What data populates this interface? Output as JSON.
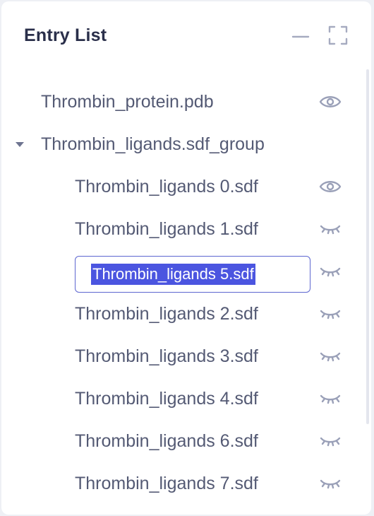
{
  "panel": {
    "title": "Entry List"
  },
  "entries": [
    {
      "label": "Thrombin_protein.pdb",
      "visibility": "visible"
    },
    {
      "label": "Thrombin_ligands.sdf_group",
      "expanded": true
    },
    {
      "label": "Thrombin_ligands 0.sdf",
      "visibility": "visible"
    },
    {
      "label": "Thrombin_ligands 1.sdf",
      "visibility": "hidden"
    },
    {
      "label": "Thrombin_ligands 5.sdf",
      "visibility": "hidden",
      "editing": true
    },
    {
      "label": "Thrombin_ligands 2.sdf",
      "visibility": "hidden"
    },
    {
      "label": "Thrombin_ligands 3.sdf",
      "visibility": "hidden"
    },
    {
      "label": "Thrombin_ligands 4.sdf",
      "visibility": "hidden"
    },
    {
      "label": "Thrombin_ligands 6.sdf",
      "visibility": "hidden"
    },
    {
      "label": "Thrombin_ligands 7.sdf",
      "visibility": "hidden"
    }
  ],
  "colors": {
    "title": "#2a2f4a",
    "text": "#545a74",
    "icon": "#9aa0b8",
    "selection": "#4b55e0",
    "input_border": "#5d66d0"
  },
  "icons": {
    "minimize": "minimize-icon",
    "fullscreen": "fullscreen-icon",
    "visible": "eye-icon",
    "hidden": "eye-closed-icon",
    "expand": "caret-down-icon"
  }
}
